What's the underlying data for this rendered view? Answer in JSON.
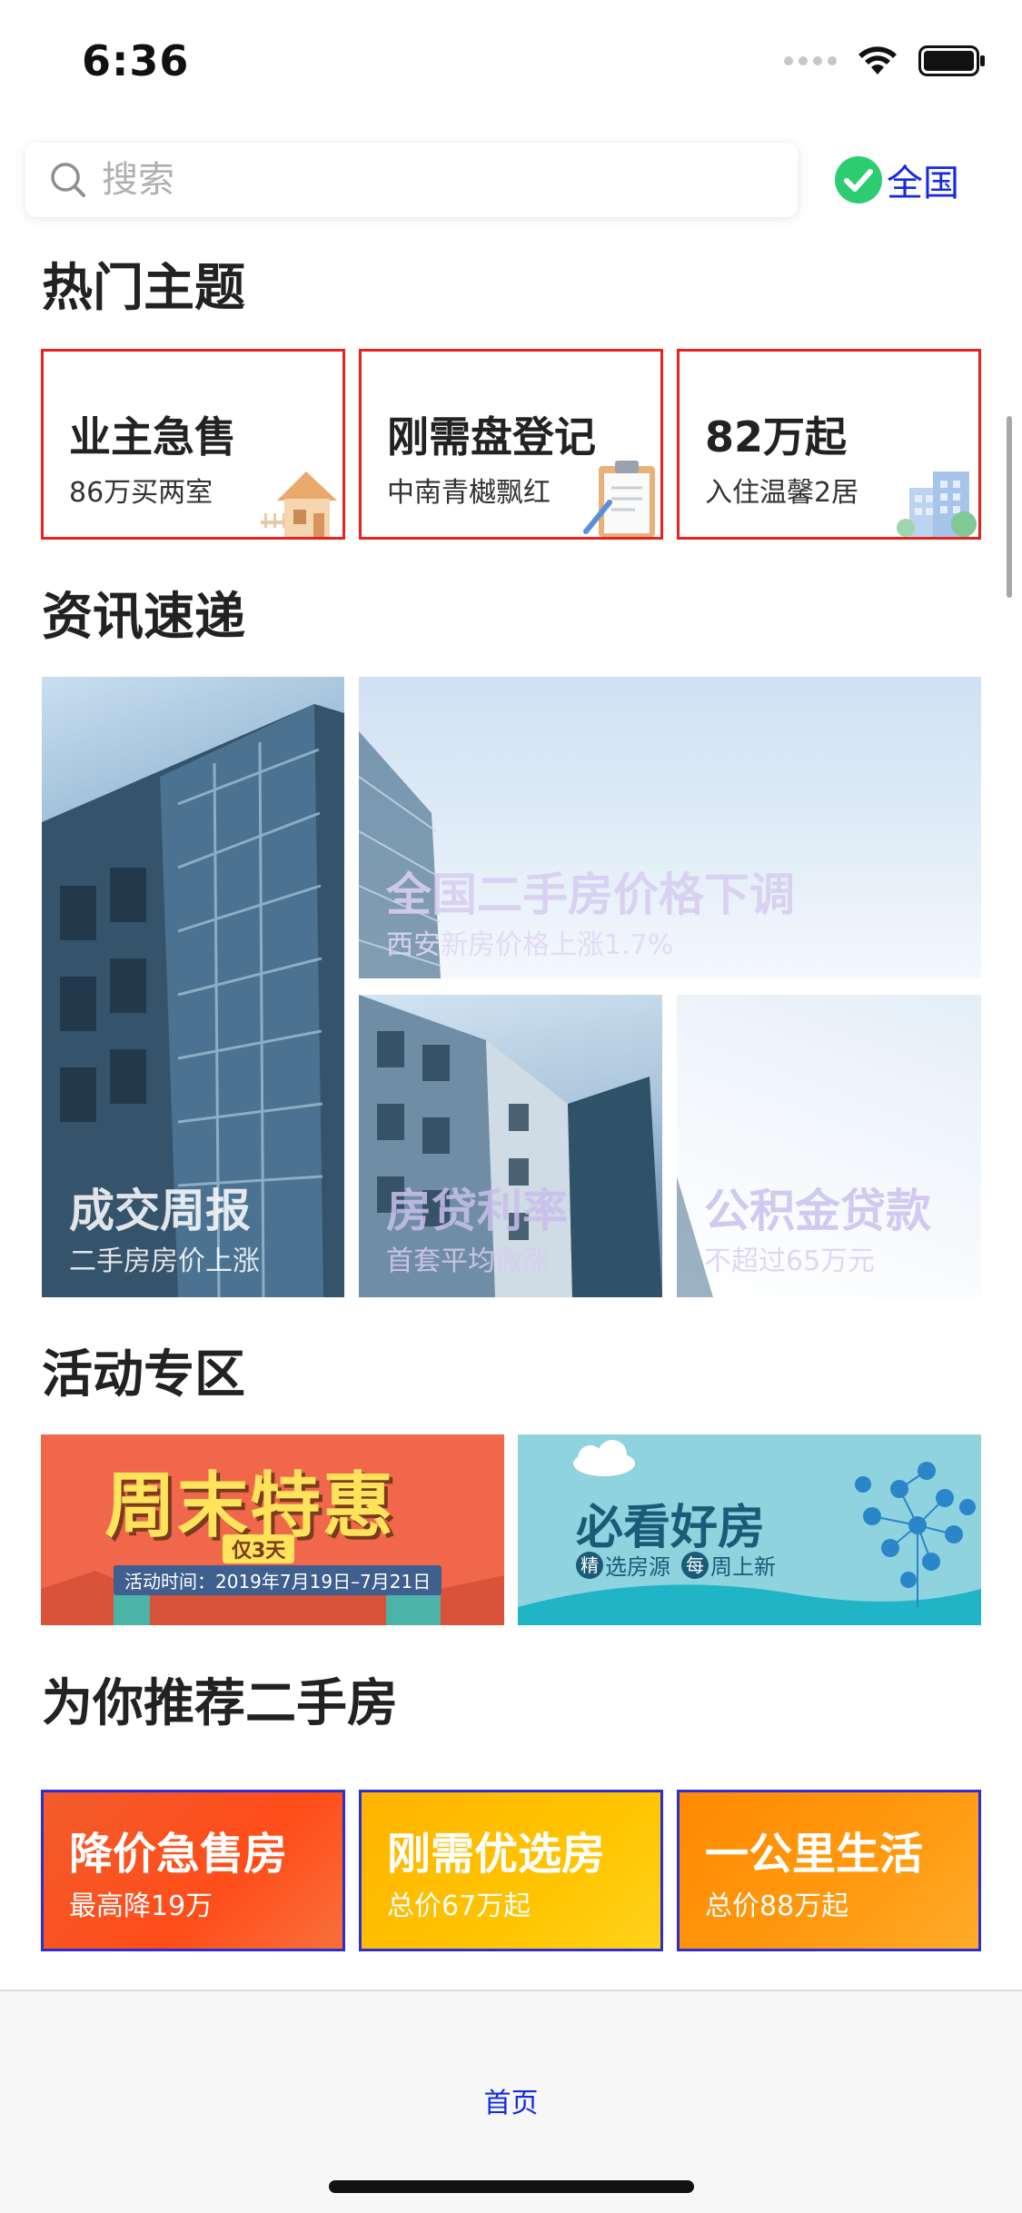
{
  "status": {
    "time": "6:36"
  },
  "search": {
    "placeholder": "搜索"
  },
  "region": {
    "label": "全国"
  },
  "sections": {
    "hot": "热门主题",
    "news": "资讯速递",
    "activity": "活动专区",
    "recommend": "为你推荐二手房"
  },
  "hot_topics": [
    {
      "title": "业主急售",
      "subtitle": "86万买两室",
      "icon": "house-icon"
    },
    {
      "title": "刚需盘登记",
      "subtitle": "中南青樾飘红",
      "icon": "clipboard-icon"
    },
    {
      "title": "82万起",
      "subtitle": "入住温馨2居",
      "icon": "buildings-icon"
    }
  ],
  "news": [
    {
      "title": "全国二手房价格下调",
      "subtitle": "西安新房价格上涨1.7%"
    },
    {
      "title": "成交周报",
      "subtitle": "二手房房价上涨"
    },
    {
      "title": "房贷利率",
      "subtitle": "首套平均微涨"
    },
    {
      "title": "公积金贷款",
      "subtitle": "不超过65万元"
    }
  ],
  "activities": [
    {
      "title": "周末特惠",
      "tag": "仅3天",
      "date_text": "活动时间：2019年7月19日–7月21日"
    },
    {
      "title": "必看好房",
      "subtitle_a": "精",
      "subtitle_b": "选房源",
      "subtitle_c": "每",
      "subtitle_d": "周上新"
    }
  ],
  "recommend": [
    {
      "title": "降价急售房",
      "subtitle": "最高降19万"
    },
    {
      "title": "刚需优选房",
      "subtitle": "总价67万起"
    },
    {
      "title": "一公里生活",
      "subtitle": "总价88万起"
    }
  ],
  "tab_bar": {
    "home": "首页"
  },
  "colors": {
    "accent_blue": "#1428e6",
    "hot_border": "#e8231e",
    "recommend_border": "#2d2dd2",
    "check_green": "#2ecc71"
  }
}
